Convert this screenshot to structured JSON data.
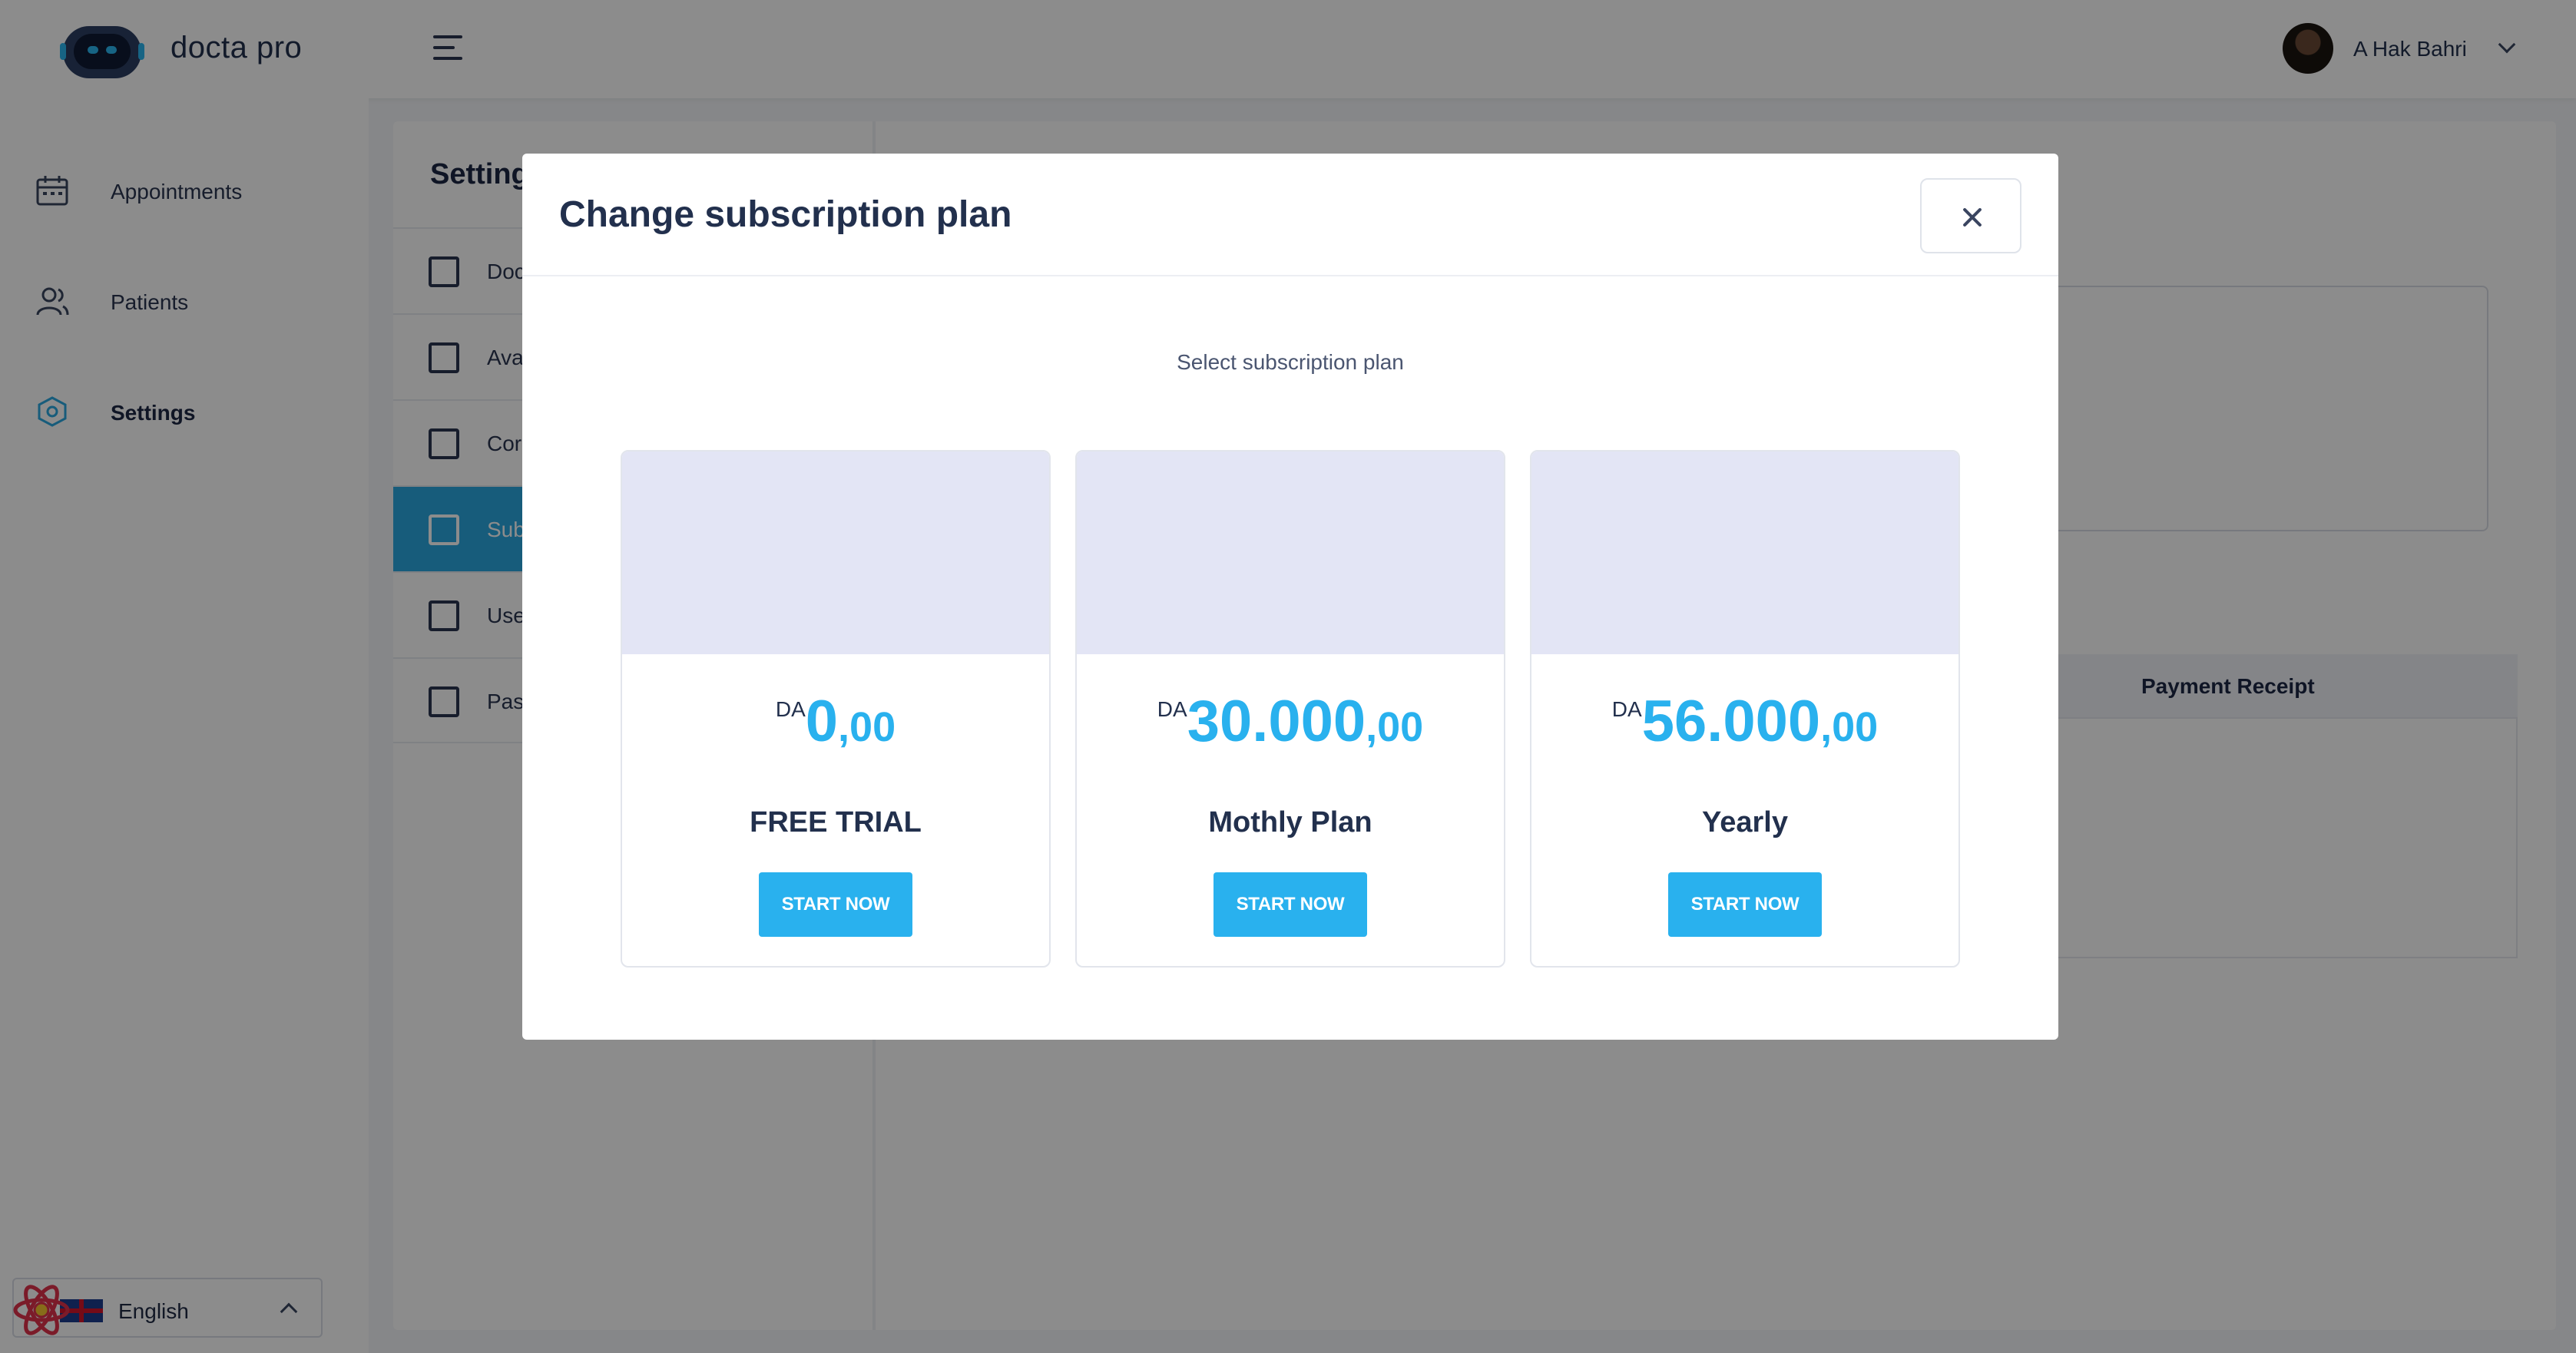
{
  "header": {
    "brand": "docta pro",
    "user_name": "A Hak Bahri"
  },
  "sidebar": {
    "items": [
      {
        "label": "Appointments",
        "icon": "calendar-icon"
      },
      {
        "label": "Patients",
        "icon": "users-icon"
      },
      {
        "label": "Settings",
        "icon": "settings-hexagon-icon",
        "active": true
      }
    ],
    "language": "English"
  },
  "settings": {
    "title": "Setting",
    "items": [
      {
        "label": "Doc",
        "icon": "hospital-icon"
      },
      {
        "label": "Ava",
        "icon": "calendar-icon"
      },
      {
        "label": "Cor",
        "icon": "medical-kit-icon"
      },
      {
        "label": "Sub",
        "icon": "card-icon",
        "active": true
      },
      {
        "label": "Use",
        "icon": "shield-user-icon"
      },
      {
        "label": "Pas",
        "icon": "lock-icon"
      }
    ],
    "table_header": "Payment Receipt"
  },
  "modal": {
    "title": "Change subscription plan",
    "subtitle": "Select subscription plan",
    "plans": [
      {
        "currency": "DA",
        "integer": "0",
        "decimal": ",00",
        "name": "FREE TRIAL",
        "button": "START NOW"
      },
      {
        "currency": "DA",
        "integer": "30.000",
        "decimal": ",00",
        "name": "Mothly Plan",
        "button": "START NOW"
      },
      {
        "currency": "DA",
        "integer": "56.000",
        "decimal": ",00",
        "name": "Yearly",
        "button": "START NOW"
      }
    ]
  },
  "colors": {
    "accent": "#29b1ee",
    "banner": "#e3e5f5",
    "overlay": "rgba(0,0,0,0.45)"
  }
}
